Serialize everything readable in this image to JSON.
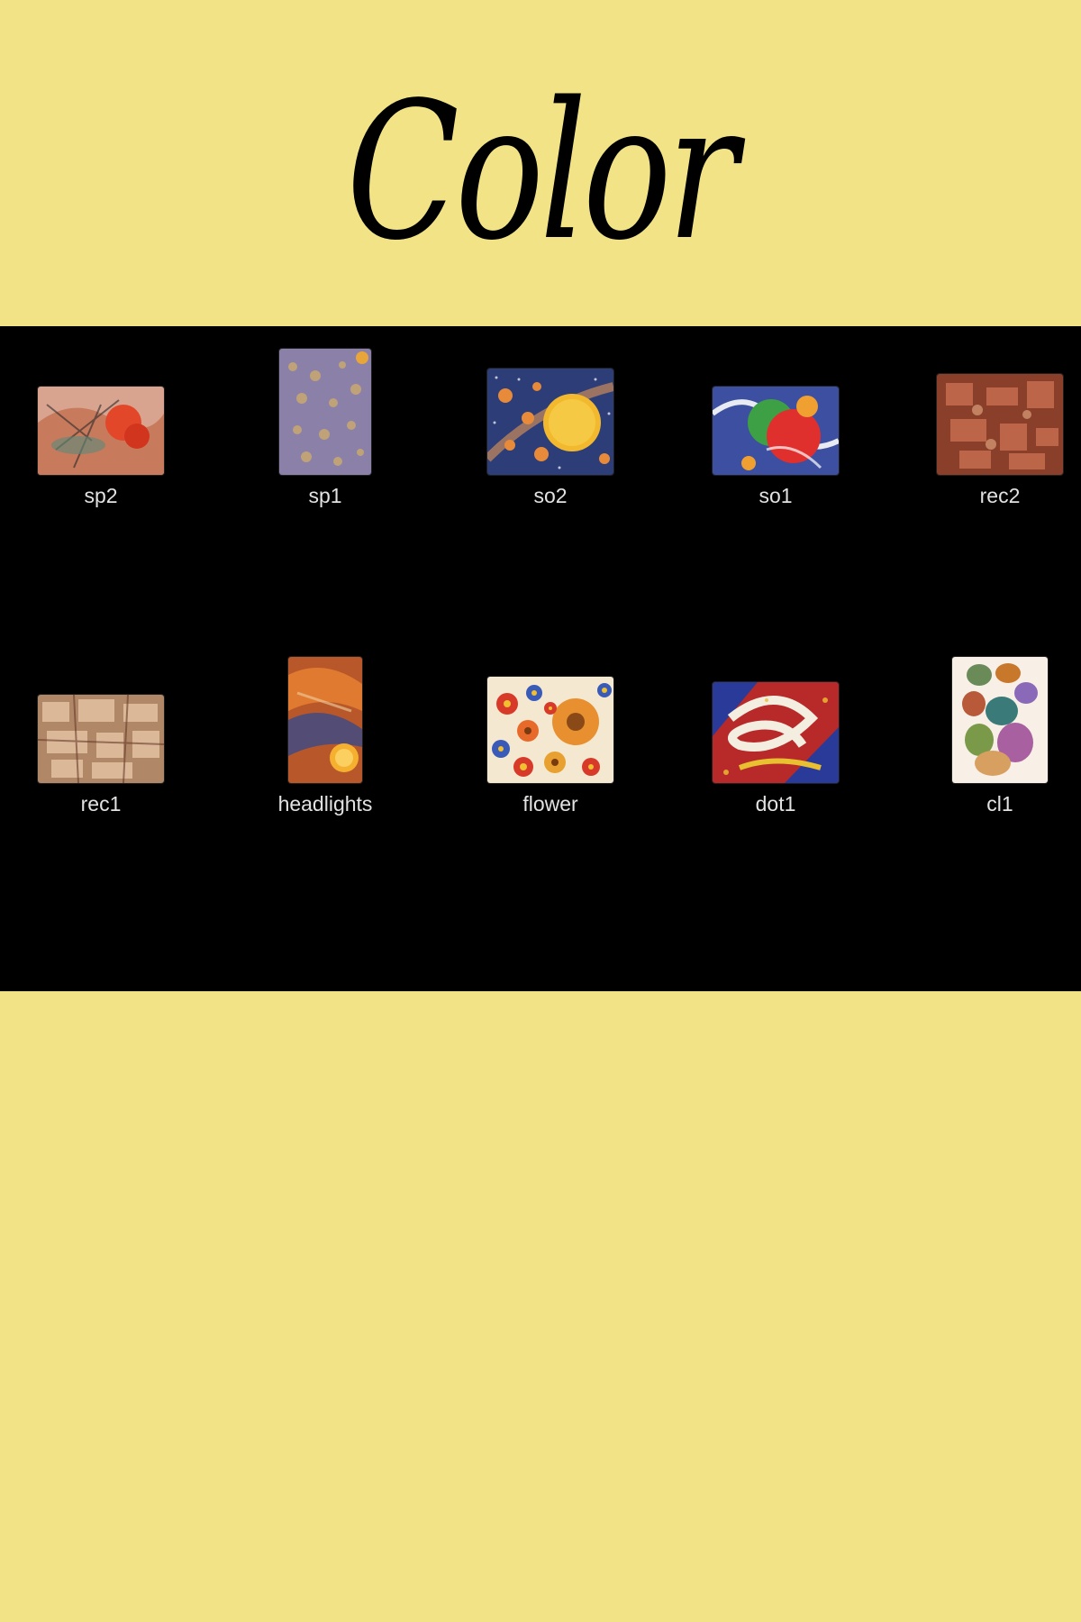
{
  "header": {
    "title": "Color"
  },
  "gallery": {
    "items": [
      {
        "label": "sp2",
        "icon": "painting-sp2-thumbnail"
      },
      {
        "label": "sp1",
        "icon": "painting-sp1-thumbnail"
      },
      {
        "label": "so2",
        "icon": "painting-so2-thumbnail"
      },
      {
        "label": "so1",
        "icon": "painting-so1-thumbnail"
      },
      {
        "label": "rec2",
        "icon": "painting-rec2-thumbnail"
      },
      {
        "label": "rec1",
        "icon": "painting-rec1-thumbnail"
      },
      {
        "label": "headlights",
        "icon": "painting-headlights-thumbnail"
      },
      {
        "label": "flower",
        "icon": "painting-flower-thumbnail"
      },
      {
        "label": "dot1",
        "icon": "painting-dot1-thumbnail"
      },
      {
        "label": "cl1",
        "icon": "painting-cl1-thumbnail"
      }
    ]
  },
  "colors": {
    "background": "#f2e486",
    "gallery_background": "#000000",
    "label_text": "#e2e2e2",
    "title_text": "#000000"
  }
}
